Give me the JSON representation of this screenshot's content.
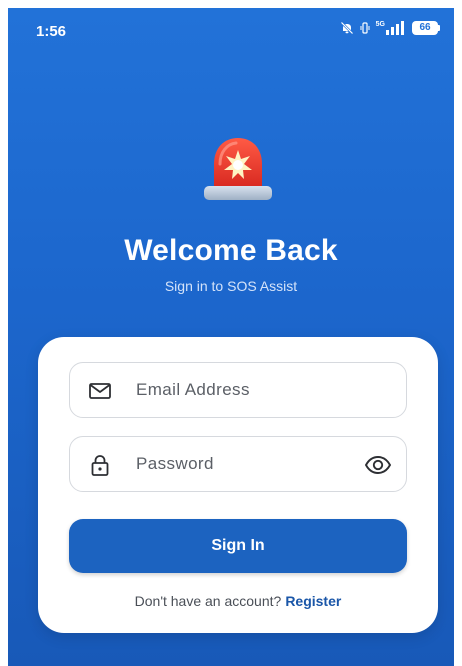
{
  "status_bar": {
    "time": "1:56",
    "battery_level": "66",
    "network_label": "5G",
    "icons": [
      "mute-bell-icon",
      "vibrate-icon",
      "signal-icon",
      "battery-icon"
    ]
  },
  "hero": {
    "icon": "siren-icon",
    "title": "Welcome Back",
    "subtitle": "Sign in to SOS Assist"
  },
  "form": {
    "email_placeholder": "Email Address",
    "email_value": "",
    "email_icon": "mail-icon",
    "password_placeholder": "Password",
    "password_value": "",
    "password_icon": "lock-icon",
    "visibility_icon": "eye-icon",
    "submit_label": "Sign In"
  },
  "footer": {
    "prompt": "Don't have an account?",
    "link_label": "Register"
  },
  "colors": {
    "background": "#2272d8",
    "primary_button": "#1c63c0",
    "link": "#1a56a8",
    "siren_red": "#e8352b"
  }
}
